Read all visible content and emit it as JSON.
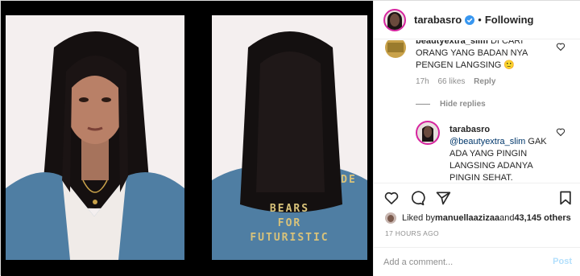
{
  "photo": {
    "jacket_text_right": [
      "BEARS",
      "FOR",
      "FUTURISTIC"
    ],
    "jacket_text_partial": "DE"
  },
  "header": {
    "username": "tarabasro",
    "separator": "•",
    "follow_label": "Following"
  },
  "comments": [
    {
      "username": "beautyextra_slim",
      "text": "DI CARI ORANG YANG BADAN NYA PENGEN LANGSING 🙂",
      "age": "17h",
      "likes": "66 likes",
      "reply_label": "Reply"
    }
  ],
  "hide_replies_label": "Hide replies",
  "reply": {
    "username": "tarabasro",
    "mention": "@beautyextra_slim",
    "text": " GAK ADA YANG PINGIN LANGSING ADANYA PINGIN SEHAT."
  },
  "likes": {
    "prefix": "Liked by ",
    "user": "manuellaazizaa",
    "connector": " and ",
    "others": "43,145 others"
  },
  "timestamp": "17 HOURS AGO",
  "add_comment": {
    "placeholder": "Add a comment...",
    "post_label": "Post"
  },
  "colors": {
    "verified": "#3897f0",
    "post_disabled": "#b2dffc",
    "secondary_text": "#8e8e8e",
    "mention": "#00376b"
  }
}
